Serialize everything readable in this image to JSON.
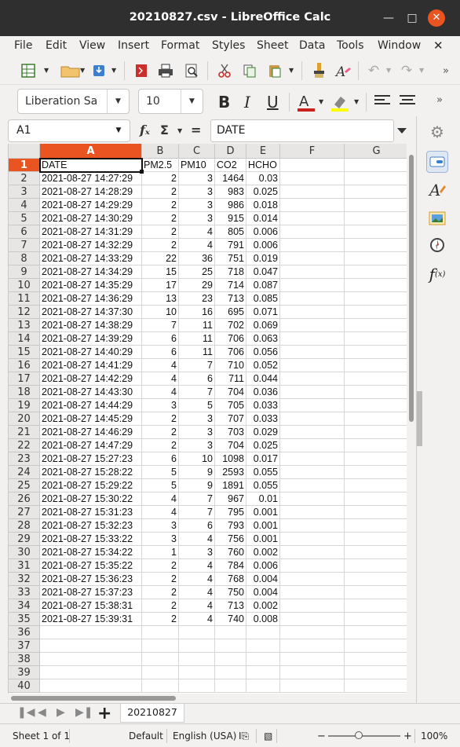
{
  "window": {
    "title": "20210827.csv - LibreOffice Calc"
  },
  "menu": [
    "File",
    "Edit",
    "View",
    "Insert",
    "Format",
    "Styles",
    "Sheet",
    "Data",
    "Tools",
    "Window"
  ],
  "font": {
    "name": "Liberation Sa",
    "size": "10"
  },
  "formula": {
    "cell_ref": "A1",
    "content": "DATE"
  },
  "columns": [
    "A",
    "B",
    "C",
    "D",
    "E",
    "F",
    "G"
  ],
  "rows": [
    [
      "DATE",
      "PM2.5",
      "PM10",
      "CO2",
      "HCHO"
    ],
    [
      "2021-08-27 14:27:29",
      "2",
      "3",
      "1464",
      "0.03"
    ],
    [
      "2021-08-27 14:28:29",
      "2",
      "3",
      "983",
      "0.025"
    ],
    [
      "2021-08-27 14:29:29",
      "2",
      "3",
      "986",
      "0.018"
    ],
    [
      "2021-08-27 14:30:29",
      "2",
      "3",
      "915",
      "0.014"
    ],
    [
      "2021-08-27 14:31:29",
      "2",
      "4",
      "805",
      "0.006"
    ],
    [
      "2021-08-27 14:32:29",
      "2",
      "4",
      "791",
      "0.006"
    ],
    [
      "2021-08-27 14:33:29",
      "22",
      "36",
      "751",
      "0.019"
    ],
    [
      "2021-08-27 14:34:29",
      "15",
      "25",
      "718",
      "0.047"
    ],
    [
      "2021-08-27 14:35:29",
      "17",
      "29",
      "714",
      "0.087"
    ],
    [
      "2021-08-27 14:36:29",
      "13",
      "23",
      "713",
      "0.085"
    ],
    [
      "2021-08-27 14:37:30",
      "10",
      "16",
      "695",
      "0.071"
    ],
    [
      "2021-08-27 14:38:29",
      "7",
      "11",
      "702",
      "0.069"
    ],
    [
      "2021-08-27 14:39:29",
      "6",
      "11",
      "706",
      "0.063"
    ],
    [
      "2021-08-27 14:40:29",
      "6",
      "11",
      "706",
      "0.056"
    ],
    [
      "2021-08-27 14:41:29",
      "4",
      "7",
      "710",
      "0.052"
    ],
    [
      "2021-08-27 14:42:29",
      "4",
      "6",
      "711",
      "0.044"
    ],
    [
      "2021-08-27 14:43:30",
      "4",
      "7",
      "704",
      "0.036"
    ],
    [
      "2021-08-27 14:44:29",
      "3",
      "5",
      "705",
      "0.033"
    ],
    [
      "2021-08-27 14:45:29",
      "2",
      "3",
      "707",
      "0.033"
    ],
    [
      "2021-08-27 14:46:29",
      "2",
      "3",
      "703",
      "0.029"
    ],
    [
      "2021-08-27 14:47:29",
      "2",
      "3",
      "704",
      "0.025"
    ],
    [
      "2021-08-27 15:27:23",
      "6",
      "10",
      "1098",
      "0.017"
    ],
    [
      "2021-08-27 15:28:22",
      "5",
      "9",
      "2593",
      "0.055"
    ],
    [
      "2021-08-27 15:29:22",
      "5",
      "9",
      "1891",
      "0.055"
    ],
    [
      "2021-08-27 15:30:22",
      "4",
      "7",
      "967",
      "0.01"
    ],
    [
      "2021-08-27 15:31:23",
      "4",
      "7",
      "795",
      "0.001"
    ],
    [
      "2021-08-27 15:32:23",
      "3",
      "6",
      "793",
      "0.001"
    ],
    [
      "2021-08-27 15:33:22",
      "3",
      "4",
      "756",
      "0.001"
    ],
    [
      "2021-08-27 15:34:22",
      "1",
      "3",
      "760",
      "0.002"
    ],
    [
      "2021-08-27 15:35:22",
      "2",
      "4",
      "784",
      "0.006"
    ],
    [
      "2021-08-27 15:36:23",
      "2",
      "4",
      "768",
      "0.004"
    ],
    [
      "2021-08-27 15:37:23",
      "2",
      "4",
      "750",
      "0.004"
    ],
    [
      "2021-08-27 15:38:31",
      "2",
      "4",
      "713",
      "0.002"
    ],
    [
      "2021-08-27 15:39:31",
      "2",
      "4",
      "740",
      "0.008"
    ]
  ],
  "total_rows_visible": 40,
  "sheet_tab": "20210827",
  "status": {
    "sheet": "Sheet 1 of 1",
    "style": "Default",
    "language": "English (USA)",
    "zoom_minus": "−",
    "zoom_plus": "+",
    "zoom": "100%"
  },
  "colors": {
    "accent": "#e95420",
    "titlebar": "#2f2f2f"
  }
}
